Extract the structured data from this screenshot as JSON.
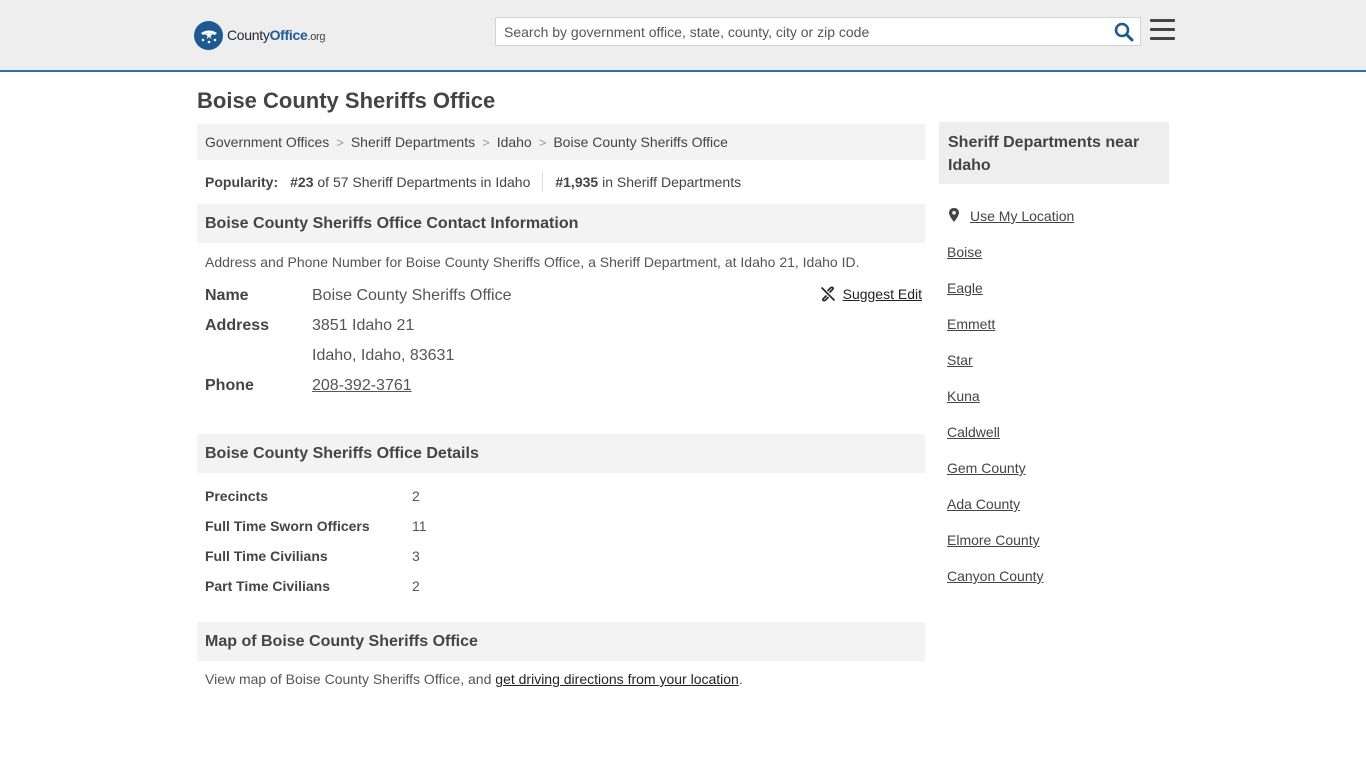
{
  "header": {
    "logo": {
      "brand": "County",
      "brand_bold": "Office",
      "suffix": ".org"
    },
    "search": {
      "placeholder": "Search by government office, state, county, city or zip code",
      "value": ""
    }
  },
  "page": {
    "title": "Boise County Sheriffs Office"
  },
  "breadcrumb": [
    {
      "label": "Government Offices"
    },
    {
      "label": "Sheriff Departments"
    },
    {
      "label": "Idaho"
    },
    {
      "label": "Boise County Sheriffs Office"
    }
  ],
  "popularity": {
    "label": "Popularity:",
    "rank_state": "#23",
    "rank_state_text": "of 57 Sheriff Departments in Idaho",
    "rank_national": "#1,935",
    "rank_national_text": "in Sheriff Departments"
  },
  "contact": {
    "heading": "Boise County Sheriffs Office Contact Information",
    "intro": "Address and Phone Number for Boise County Sheriffs Office, a Sheriff Department, at Idaho 21, Idaho ID.",
    "name_label": "Name",
    "name": "Boise County Sheriffs Office",
    "address_label": "Address",
    "address_line1": "3851 Idaho 21",
    "address_line2": "Idaho, Idaho, 83631",
    "phone_label": "Phone",
    "phone": "208-392-3761",
    "suggest_edit": "Suggest Edit"
  },
  "details": {
    "heading": "Boise County Sheriffs Office Details",
    "rows": [
      {
        "label": "Precincts",
        "value": "2"
      },
      {
        "label": "Full Time Sworn Officers",
        "value": "11"
      },
      {
        "label": "Full Time Civilians",
        "value": "3"
      },
      {
        "label": "Part Time Civilians",
        "value": "2"
      }
    ]
  },
  "map": {
    "heading": "Map of Boise County Sheriffs Office",
    "text_before": "View map of Boise County Sheriffs Office, and ",
    "link": "get driving directions from your location",
    "text_after": "."
  },
  "sidebar": {
    "heading": "Sheriff Departments near Idaho",
    "use_location": "Use My Location",
    "items": [
      {
        "label": "Boise"
      },
      {
        "label": "Eagle"
      },
      {
        "label": "Emmett"
      },
      {
        "label": "Star"
      },
      {
        "label": "Kuna"
      },
      {
        "label": "Caldwell"
      },
      {
        "label": "Gem County"
      },
      {
        "label": "Ada County"
      },
      {
        "label": "Elmore County"
      },
      {
        "label": "Canyon County"
      }
    ]
  },
  "icons": {
    "logo": "seal-stars-icon",
    "search": "search-icon",
    "menu": "hamburger-menu-icon",
    "suggest": "broken-link-icon",
    "location": "map-pin-icon"
  },
  "colors": {
    "brand": "#1d5a92",
    "header_bg": "#eeeeef",
    "section_bg": "#f3f3f3"
  }
}
